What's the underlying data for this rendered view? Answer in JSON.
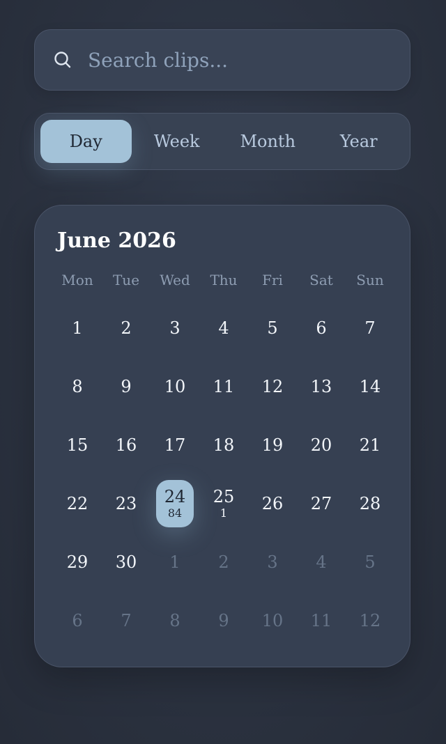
{
  "search": {
    "placeholder": "Search clips..."
  },
  "range": {
    "options": [
      "Day",
      "Week",
      "Month",
      "Year"
    ],
    "selected": "Day"
  },
  "calendar": {
    "title": "June 2026",
    "weekdays": [
      "Mon",
      "Tue",
      "Wed",
      "Thu",
      "Fri",
      "Sat",
      "Sun"
    ],
    "days": [
      {
        "day": "1",
        "current": true
      },
      {
        "day": "2",
        "current": true
      },
      {
        "day": "3",
        "current": true
      },
      {
        "day": "4",
        "current": true
      },
      {
        "day": "5",
        "current": true
      },
      {
        "day": "6",
        "current": true
      },
      {
        "day": "7",
        "current": true
      },
      {
        "day": "8",
        "current": true
      },
      {
        "day": "9",
        "current": true
      },
      {
        "day": "10",
        "current": true
      },
      {
        "day": "11",
        "current": true
      },
      {
        "day": "12",
        "current": true
      },
      {
        "day": "13",
        "current": true
      },
      {
        "day": "14",
        "current": true
      },
      {
        "day": "15",
        "current": true
      },
      {
        "day": "16",
        "current": true
      },
      {
        "day": "17",
        "current": true
      },
      {
        "day": "18",
        "current": true
      },
      {
        "day": "19",
        "current": true
      },
      {
        "day": "20",
        "current": true
      },
      {
        "day": "21",
        "current": true
      },
      {
        "day": "22",
        "current": true
      },
      {
        "day": "23",
        "current": true
      },
      {
        "day": "24",
        "current": true,
        "count": "84",
        "selected": true
      },
      {
        "day": "25",
        "current": true,
        "count": "1"
      },
      {
        "day": "26",
        "current": true
      },
      {
        "day": "27",
        "current": true
      },
      {
        "day": "28",
        "current": true
      },
      {
        "day": "29",
        "current": true
      },
      {
        "day": "30",
        "current": true
      },
      {
        "day": "1",
        "current": false
      },
      {
        "day": "2",
        "current": false
      },
      {
        "day": "3",
        "current": false
      },
      {
        "day": "4",
        "current": false
      },
      {
        "day": "5",
        "current": false
      },
      {
        "day": "6",
        "current": false
      },
      {
        "day": "7",
        "current": false
      },
      {
        "day": "8",
        "current": false
      },
      {
        "day": "9",
        "current": false
      },
      {
        "day": "10",
        "current": false
      },
      {
        "day": "11",
        "current": false
      },
      {
        "day": "12",
        "current": false
      }
    ]
  },
  "icons": {
    "search": "search-icon"
  },
  "colors": {
    "accent": "#a3c2d8",
    "background": "#2b3240",
    "card": "#364052"
  }
}
